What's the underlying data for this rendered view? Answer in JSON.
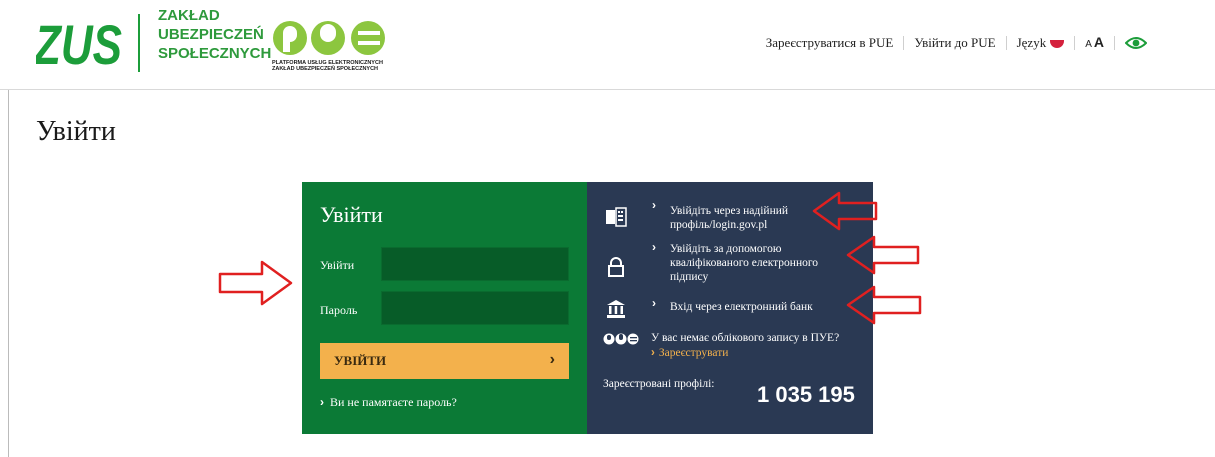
{
  "header": {
    "logo_text": "ZUS",
    "org_name": "ZAKŁAD\nUBEZPIECZEŃ\nSPOŁECZNYCH",
    "pue_logo_text": "PUE",
    "pue_subtitle": "PLATFORMA USŁUG ELEKTRONICZNYCH\nZAKŁAD UBEZPIECZEŃ SPOŁECZNYCH",
    "nav": {
      "register": "Зареєструватися в PUE",
      "login": "Увійти до PUE",
      "language": "Język",
      "font_small": "A",
      "font_big": "A"
    }
  },
  "page": {
    "title": "Увійти"
  },
  "login_form": {
    "heading": "Увійти",
    "username_label": "Увійти",
    "username_value": "",
    "password_label": "Пароль",
    "password_value": "",
    "submit_label": "УВІЙТИ",
    "forgot_label": "Ви не памятаєте пароль?"
  },
  "alt_login": {
    "options": [
      {
        "icon": "id-card-icon",
        "text": "Увійдіть через надійний\nпрофіль/login.gov.pl"
      },
      {
        "icon": "lock-icon",
        "text": "Увійдіть за допомогою\nкваліфікованого електронного\nпідпису"
      },
      {
        "icon": "bank-icon",
        "text": "Вхід через електронний банк"
      }
    ],
    "no_account_question": "У вас немає облікового запису в ПУЕ?",
    "register_link": "Зареєструвати",
    "registered_profiles_label": "Зареєстровані профілі:",
    "registered_profiles_count": "1 035 195"
  },
  "colors": {
    "brand_green": "#0b7a36",
    "panel_navy": "#2a3953",
    "button_orange": "#f3b14c",
    "annotation_red": "#e02020"
  }
}
